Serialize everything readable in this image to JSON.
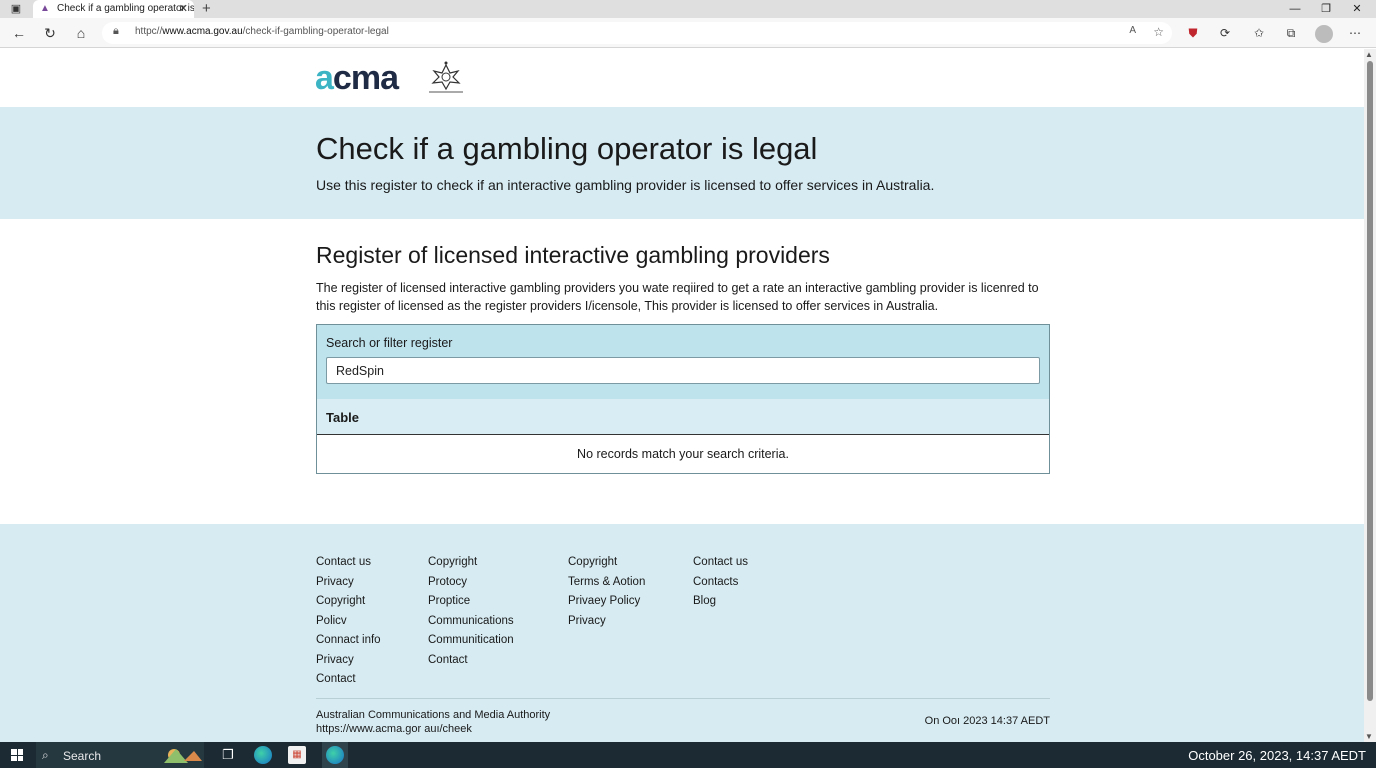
{
  "browser": {
    "tab_title": "Check if a gambling operator is legal",
    "url_prefix": "httpc//",
    "url_host": "www.acma.gov.au",
    "url_path": "/check-if-gambling-operator-legal",
    "icons": {
      "back": "back-arrow-icon",
      "refresh": "refresh-icon",
      "home": "home-icon",
      "lock": "lock-icon",
      "favorite": "star-icon"
    }
  },
  "header": {
    "logo_a": "a",
    "logo_rest": "cma"
  },
  "hero": {
    "title": "Check if a gambling operator is legal",
    "subtitle": "Use this register to check if an interactive gambling provider is licensed to offer services in Australia."
  },
  "section": {
    "title": "Register of licensed interactive gambling providers",
    "description": "The register of licensed interactive gambling providers you wate reqiired to get a rate an interactive gambling provider is licenred to this register of licensed as the register providers I/icensole, This provider is licensed to offer services in Australia."
  },
  "register": {
    "search_label": "Search or filter register",
    "search_value": "RedSpin",
    "table_heading": "Table",
    "empty_message": "No records match your search criteria."
  },
  "footer": {
    "columns": [
      [
        "Contact us",
        "Privacy",
        "Copyright",
        "Policv",
        "Connact info",
        "Privacy",
        "Contact"
      ],
      [
        "Copyright",
        "Protocy",
        "Proptice",
        "Communications",
        "Communitication",
        "Contact"
      ],
      [
        "Copyright",
        "Terms & Aotion",
        "Privaey Policy",
        "Privacy"
      ],
      [
        "Contact us",
        "Contacts",
        "Blog"
      ]
    ],
    "org_name": "Australian Communications and Media Authority",
    "org_url": "https://www.acma.gor auı/cheek",
    "date": "On Ooı 2023 14:37 AEDT"
  },
  "taskbar": {
    "search_label": "Search",
    "clock": "October 26, 2023, 14:37 AEDT"
  },
  "colors": {
    "hero_bg": "#d6ebf2",
    "register_header_bg": "#bfe3ed",
    "logo_accent": "#3cb4c4",
    "logo_dark": "#1f2a44",
    "taskbar_bg": "#1c2b33"
  }
}
